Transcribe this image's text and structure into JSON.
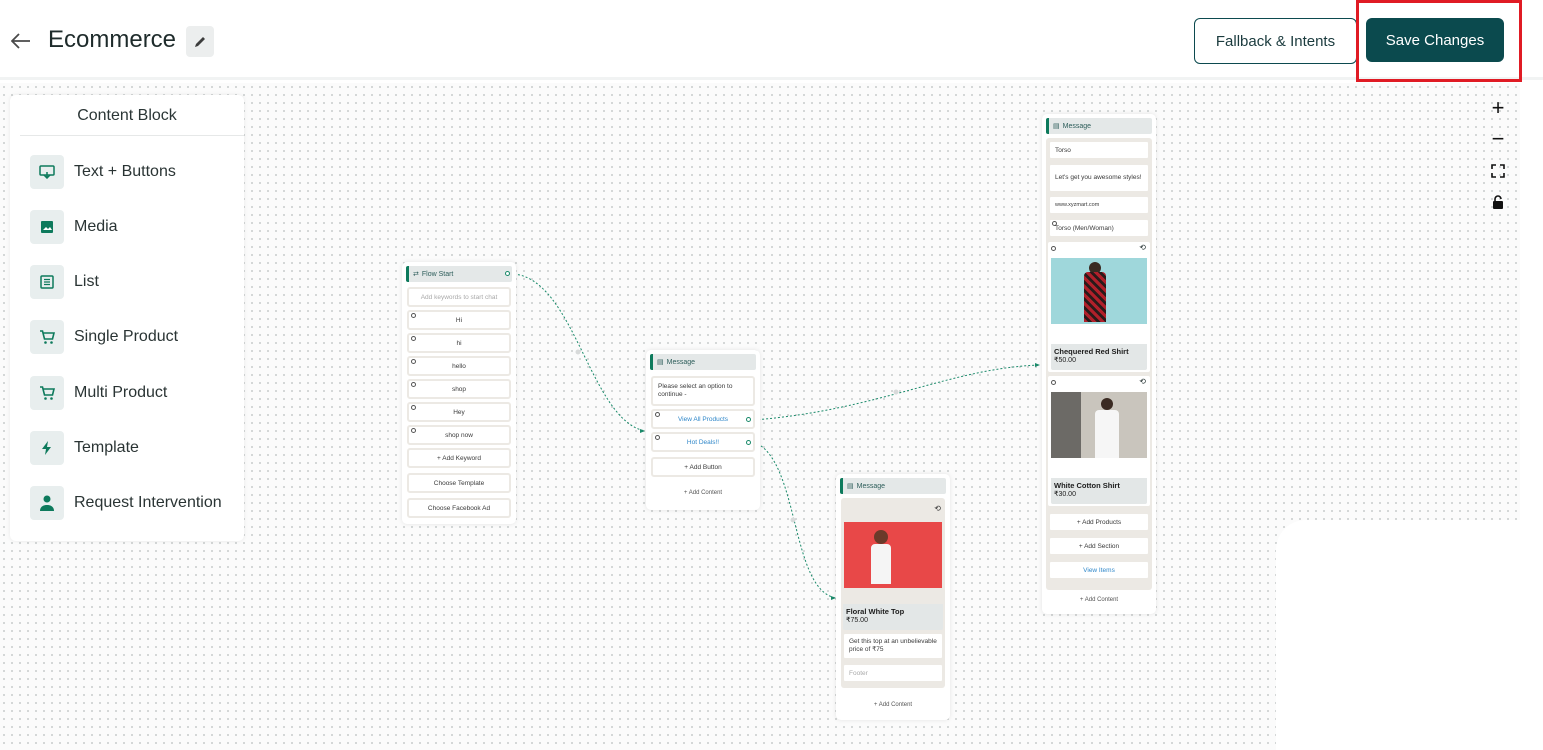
{
  "header": {
    "back_icon": "arrow-left-icon",
    "title": "Ecommerce",
    "edit_icon": "pencil-icon",
    "fallback_label": "Fallback & Intents",
    "save_label": "Save Changes",
    "accent_color": "#0b4a4e",
    "highlight_color": "#e01b24"
  },
  "content_block": {
    "title": "Content Block",
    "items": [
      {
        "label": "Text + Buttons",
        "icon": "text-buttons-icon"
      },
      {
        "label": "Media",
        "icon": "image-icon"
      },
      {
        "label": "List",
        "icon": "list-icon"
      },
      {
        "label": "Single Product",
        "icon": "cart-icon"
      },
      {
        "label": "Multi Product",
        "icon": "cart-icon"
      },
      {
        "label": "Template",
        "icon": "lightning-icon"
      },
      {
        "label": "Request Intervention",
        "icon": "agent-icon"
      }
    ]
  },
  "zoom_controls": {
    "zoom_in": "+",
    "zoom_out": "−",
    "fit_icon": "fit-view-icon",
    "lock_icon": "lock-icon"
  },
  "flow_start": {
    "title": "Flow Start",
    "placeholder": "Add keywords to start chat",
    "keywords": [
      "Hi",
      "hi",
      "hello",
      "shop",
      "Hey",
      "shop now"
    ],
    "add_keyword": "+ Add Keyword",
    "choose_template": "Choose Template",
    "choose_facebook_ad": "Choose Facebook Ad"
  },
  "message_options": {
    "title": "Message",
    "text": "Please select an option to continue -",
    "buttons": [
      "View All Products",
      "Hot Deals!!"
    ],
    "add_button": "+ Add Button",
    "add_content": "+ Add Content"
  },
  "message_hot_deal": {
    "title": "Message",
    "product_name": "Floral White Top",
    "product_price": "₹75.00",
    "body": "Get this top at an unbelievable price of ₹75",
    "footer_placeholder": "Footer",
    "add_content": "+ Add Content"
  },
  "message_products": {
    "title": "Message",
    "header": "Torso",
    "body": "Let's get you awesome styles!",
    "footer": "www.xyzmart.com",
    "section": "Torso (Men/Woman)",
    "products": [
      {
        "name": "Chequered Red Shirt",
        "price": "₹50.00"
      },
      {
        "name": "White Cotton Shirt",
        "price": "₹30.00"
      }
    ],
    "add_products": "+ Add Products",
    "add_section": "+ Add Section",
    "view_items": "View Items",
    "add_content": "+ Add Content"
  }
}
